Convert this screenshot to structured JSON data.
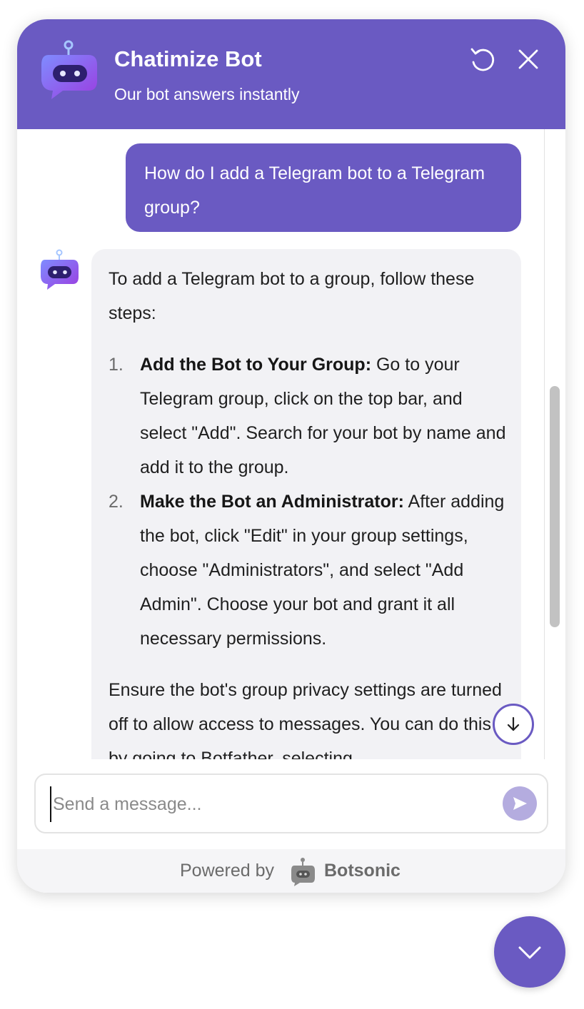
{
  "header": {
    "title": "Chatimize Bot",
    "subtitle": "Our bot answers instantly",
    "refresh_icon": "refresh-icon",
    "close_icon": "close-icon"
  },
  "conversation": {
    "user_message": "How do I add a Telegram bot to a Telegram group?",
    "bot_message": {
      "intro": "To add a Telegram bot to a group, follow these steps:",
      "steps": [
        {
          "number": "1.",
          "title": "Add the Bot to Your Group:",
          "text": " Go to your Telegram group, click on the top bar, and select \"Add\". Search for your bot by name and add it to the group."
        },
        {
          "number": "2.",
          "title": "Make the Bot an Administrator:",
          "text": " After adding the bot, click \"Edit\" in your group settings, choose \"Administrators\", and select \"Add Admin\". Choose your bot and grant it all necessary permissions."
        }
      ],
      "outro": "Ensure the bot's group privacy settings are turned off to allow access to messages. You can do this by going to Botfather, selecting"
    },
    "scroll_down_icon": "arrow-down-icon"
  },
  "composer": {
    "placeholder": "Send a message...",
    "value": "",
    "send_icon": "send-icon"
  },
  "footer": {
    "powered_by": "Powered by",
    "brand": "Botsonic"
  },
  "launcher": {
    "icon": "chevron-down-icon"
  },
  "colors": {
    "accent": "#6a5ac2",
    "bubble_bot": "#f2f2f5",
    "send_disabled": "#b4acdf"
  }
}
